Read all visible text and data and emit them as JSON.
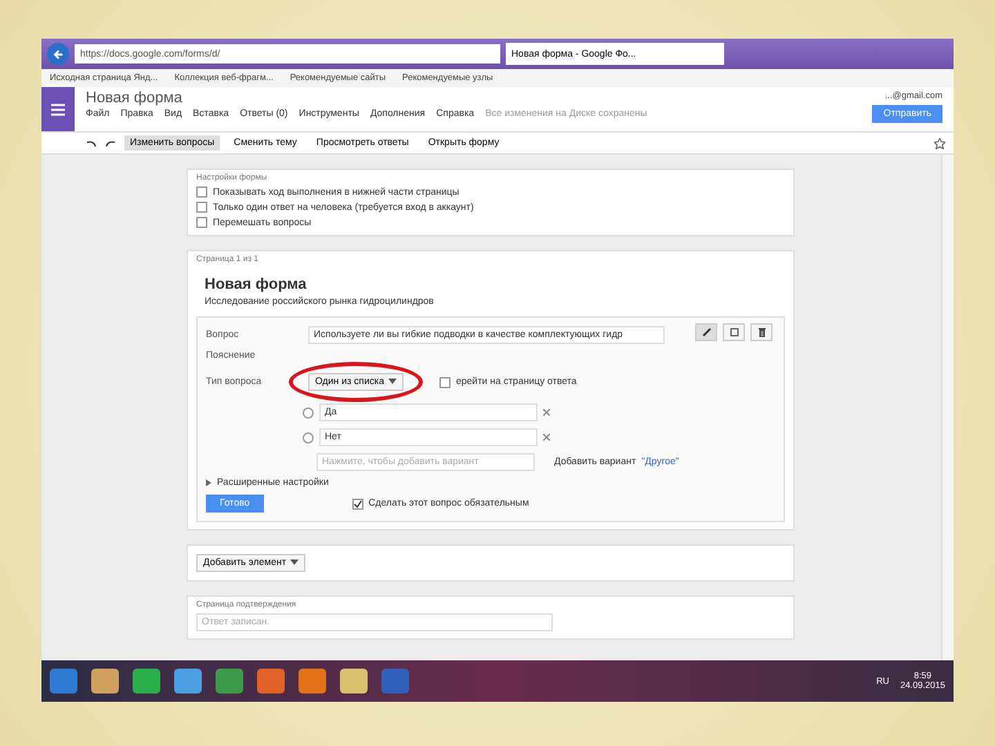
{
  "browser": {
    "url": "https://docs.google.com/forms/d/",
    "tabs": [
      {
        "label": "Новая форма - Google Фо...",
        "selected": true
      }
    ],
    "bookmarks": [
      "Исходная страница Янд...",
      "Коллекция веб-фрагм...",
      "Рекомендуемые сайты",
      "Рекомендуемые узлы"
    ]
  },
  "docs": {
    "title": "Новая форма",
    "menu": [
      "Файл",
      "Правка",
      "Вид",
      "Вставка",
      "Ответы (0)",
      "Инструменты",
      "Дополнения",
      "Справка"
    ],
    "save_status": "Все изменения на Диске сохранены",
    "account": "...@gmail.com",
    "send_button": "Отправить"
  },
  "toolbar": [
    {
      "label": "Изменить вопросы",
      "selected": true
    },
    {
      "label": "Сменить тему",
      "selected": false
    },
    {
      "label": "Просмотреть ответы",
      "selected": false
    },
    {
      "label": "Открыть форму",
      "selected": false
    }
  ],
  "settings": {
    "title": "Настройки формы",
    "options": [
      {
        "label": "Показывать ход выполнения в нижней части страницы",
        "checked": false
      },
      {
        "label": "Только один ответ на человека (требуется вход в аккаунт)",
        "checked": false
      },
      {
        "label": "Перемешать вопросы",
        "checked": false
      }
    ]
  },
  "page": {
    "label": "Страница 1 из 1",
    "title": "Новая форма",
    "description": "Исследование российского рынка гидроцилиндров",
    "question": {
      "question_label": "Вопрос",
      "question_value": "Используете ли вы гибкие подводки в качестве комплектующих гидр",
      "hint_label": "Пояснение",
      "type_label": "Тип вопроса",
      "type_value": "Один из списка",
      "go_to_page": {
        "label": "ерейти на страницу ответа",
        "checked": false
      },
      "choices": [
        {
          "value": "Да"
        },
        {
          "value": "Нет"
        }
      ],
      "new_choice_placeholder": "Нажмите, чтобы добавить вариант",
      "add_other": "Добавить вариант",
      "other_link": "\"Другое\"",
      "advanced": "Расширенные настройки",
      "done_button": "Готово",
      "required": {
        "label": "Сделать этот вопрос обязательным",
        "checked": true
      }
    }
  },
  "add_item_button": "Добавить элемент",
  "confirmation": {
    "label": "Страница подтверждения",
    "placeholder": "Ответ записан."
  },
  "taskbar": {
    "language": "RU",
    "time": "8:59",
    "date": "24.09.2015"
  }
}
